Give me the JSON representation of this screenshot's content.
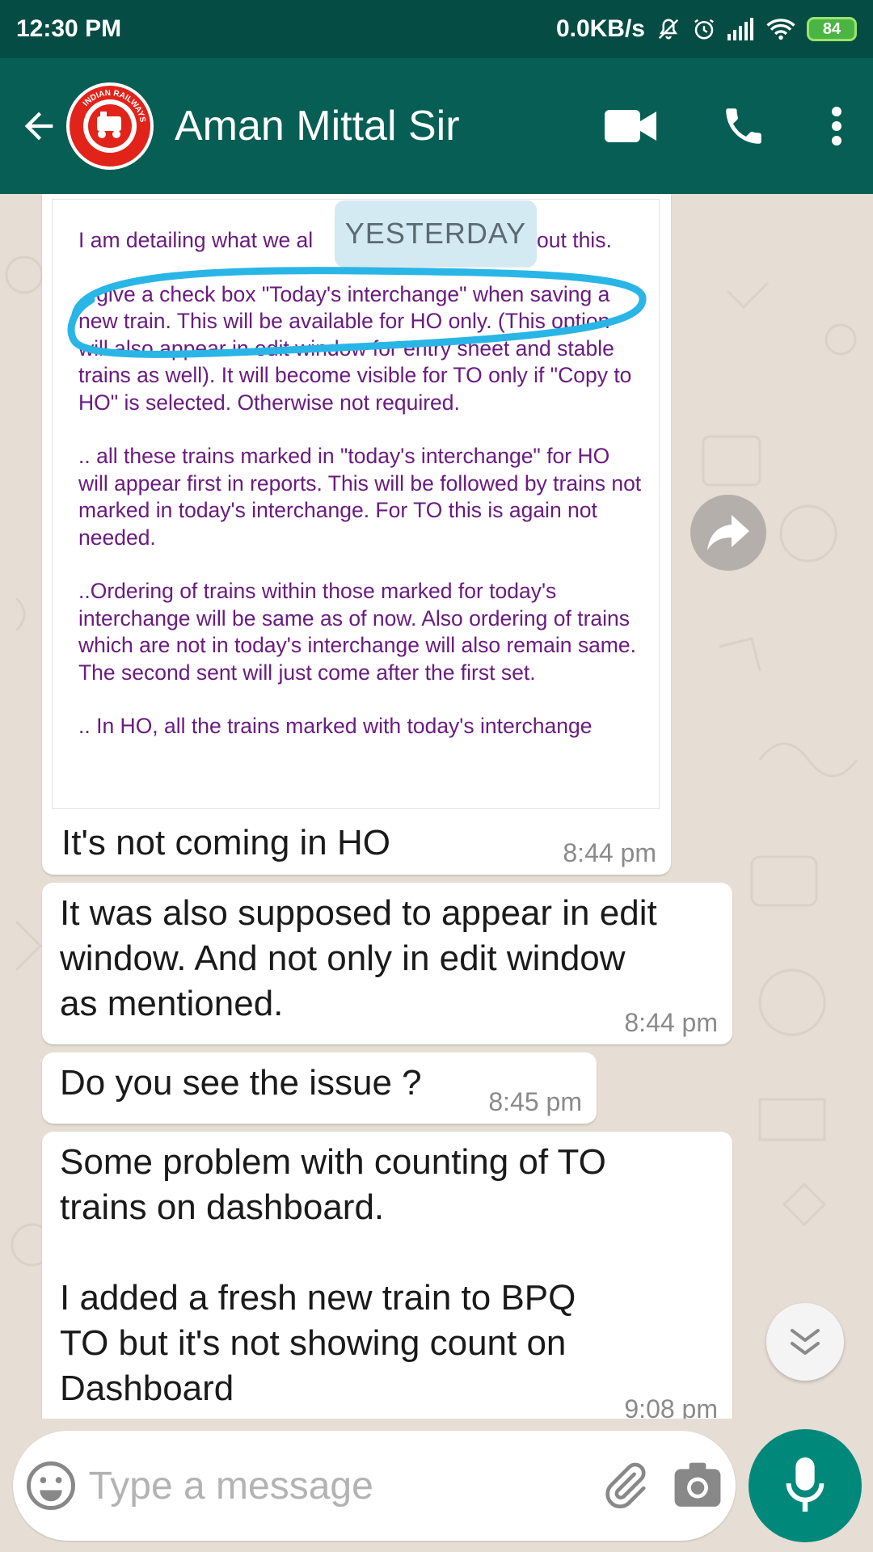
{
  "status_bar": {
    "time": "12:30 PM",
    "network_speed": "0.0KB/s",
    "battery": "84"
  },
  "header": {
    "contact_name": "Aman Mittal Sir",
    "avatar_icon": "indian-railways-logo",
    "avatar_text": "INDIAN RAILWAYS",
    "icons": [
      "back-arrow-icon",
      "video-call-icon",
      "voice-call-icon",
      "more-options-icon"
    ],
    "color": "#075e54"
  },
  "chat": {
    "date_divider": "YESTERDAY",
    "image_message": {
      "paragraphs": [
        "I am detailing what we al                ay about this.",
        ".. give a check box \"Today's interchange\" when saving a new train. This will be available for HO only. (This option will also appear in edit window for entry sheet and stable trains as well). It will become visible for TO only if \"Copy to HO\" is selected. Otherwise not required.",
        ".. all these trains marked in \"today's interchange\" for HO will appear first in reports. This will be followed by trains not marked in today's interchange. For TO this is again not needed.",
        "..Ordering of trains within those marked for today's interchange will be same as of now. Also ordering of trains which are not in today's interchange will also remain same. The second sent will just come after the first set.",
        ".. In HO, all the trains marked with today's interchange"
      ],
      "caption": "It's not coming in HO",
      "time": "8:44 pm",
      "highlight_color": "#29b6e6"
    },
    "messages": [
      {
        "text": "It was also supposed to appear in edit\nwindow. And not only in edit window\nas mentioned.",
        "time": "8:44 pm"
      },
      {
        "text": "Do you see the issue ?",
        "time": "8:45 pm"
      },
      {
        "text": "Some problem with counting of TO\ntrains on dashboard.\n\nI added a fresh new train to BPQ\nTO but it's not showing count on\nDashboard",
        "time": "9:08 pm"
      }
    ]
  },
  "input": {
    "placeholder": "Type a message",
    "icons": [
      "emoji-icon",
      "attachment-icon",
      "camera-icon",
      "microphone-icon"
    ],
    "mic_color": "#00897b"
  }
}
